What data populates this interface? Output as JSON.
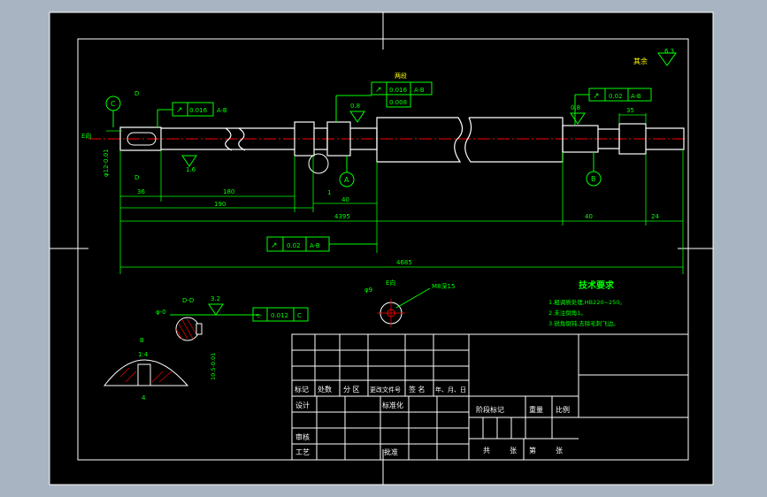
{
  "colors": {
    "background": "#a9b4c2",
    "sheet": "#000000",
    "border": "#ffffff",
    "dimension": "#00ff00",
    "outline": "#ffffff",
    "centerline": "#ff0000",
    "label": "#ffff00"
  },
  "drawing": {
    "roughness_corner": "其余",
    "roughness_corner_value": "6.3",
    "datum_e": "E向",
    "datum_c": "C",
    "datum_a": "A",
    "datum_b": "B",
    "section_d_top": "D",
    "section_d_bottom": "D",
    "both_ends": "两段",
    "tol_runout_left": "0.016",
    "tol_runout_left_ref": "A-B",
    "tol_runout_mid": "0.016",
    "tol_runout_mid_ref": "A-B",
    "tol_box_mid_value": "0.008",
    "tol_runout_right": "0.02",
    "tol_runout_right_ref": "A-B",
    "tol_bottom": "0.02",
    "tol_bottom_ref": "A-B",
    "rough_left": "1.6",
    "rough_mid": "0.8",
    "rough_right": "0.8",
    "dim_36": "36",
    "dim_180": "180",
    "dim_190": "190",
    "dim_40": "40",
    "dim_4395": "4395",
    "dim_40_right": "40",
    "dim_24": "24",
    "dim_4685": "4685",
    "dim_35": "35",
    "dim_left_dia": "φ12-0.01",
    "dim_1": "1",
    "tech_title": "技术要求",
    "tech_notes": [
      "1.粗调质处理,HB220~250。",
      "2.未注倒角1。",
      "3.锐角倒钝,去除毛刺飞边。"
    ],
    "section_dd_label": "D-D",
    "section_rough": "3.2",
    "section_dia": "φ-0",
    "section_tol_value": "0.012",
    "section_tol_ref": "C",
    "section_depth": "10.5-0.01",
    "e_view_label": "E向",
    "e_view_dia": "φ9",
    "e_view_hole": "M8深15",
    "key_b": "B",
    "key_ratio": "1:4",
    "key_width": "4"
  },
  "title_block": {
    "headers": [
      "标记",
      "处数",
      "分 区",
      "更改文件号",
      "签 名",
      "年、月、日"
    ],
    "design": "设计",
    "standardize": "标准化",
    "review": "审核",
    "process": "工艺",
    "approve": "批准",
    "stage_mark": "阶段标记",
    "weight": "重量",
    "scale": "比例",
    "sheets_total": "共",
    "sheet_unit_1": "张",
    "sheet_no": "第",
    "sheet_unit_2": "张"
  }
}
